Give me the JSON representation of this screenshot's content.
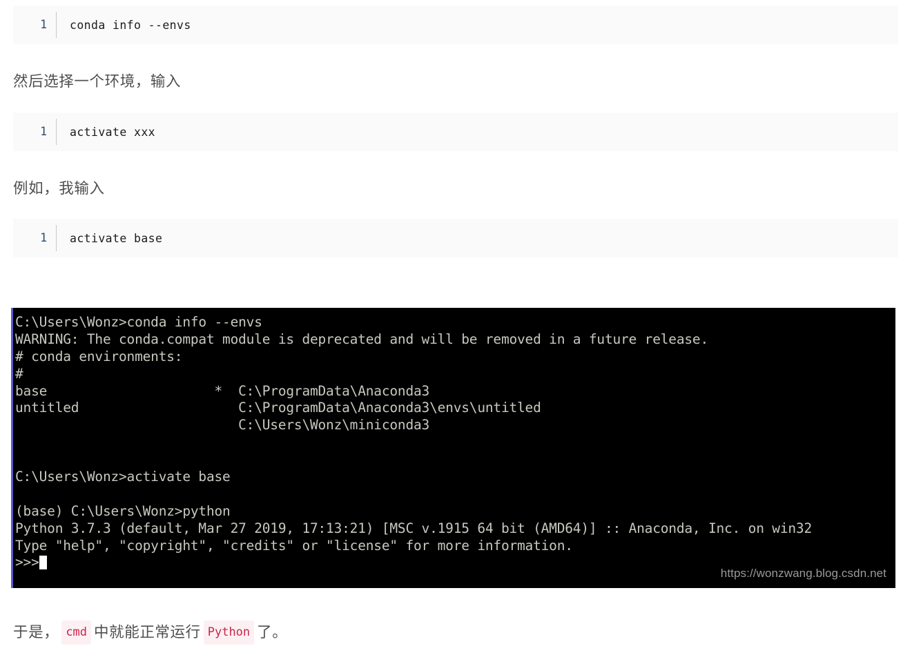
{
  "code_blocks": [
    {
      "line_no": "1",
      "code": "conda info --envs"
    },
    {
      "line_no": "1",
      "code": "activate xxx"
    },
    {
      "line_no": "1",
      "code": "activate base"
    }
  ],
  "paragraphs": {
    "p1": "然后选择一个环境，输入",
    "p2": "例如，我输入",
    "p3": {
      "before": "于是，",
      "code1": "cmd",
      "middle": "中就能正常运行",
      "code2": "Python",
      "after": "了。"
    }
  },
  "terminal": {
    "background": "#000000",
    "text_color": "#c8c8c0",
    "border_color": "#5a5ac8",
    "lines": [
      "C:\\Users\\Wonz>conda info --envs",
      "WARNING: The conda.compat module is deprecated and will be removed in a future release.",
      "# conda environments:",
      "#",
      "base                     *  C:\\ProgramData\\Anaconda3",
      "untitled                    C:\\ProgramData\\Anaconda3\\envs\\untitled",
      "                            C:\\Users\\Wonz\\miniconda3",
      "",
      "",
      "C:\\Users\\Wonz>activate base",
      "",
      "(base) C:\\Users\\Wonz>python",
      "Python 3.7.3 (default, Mar 27 2019, 17:13:21) [MSC v.1915 64 bit (AMD64)] :: Anaconda, Inc. on win32",
      "Type \"help\", \"copyright\", \"credits\" or \"license\" for more information."
    ],
    "prompt": ">>>",
    "watermark": "https://wonzwang.blog.csdn.net"
  },
  "colors": {
    "code_block_bg": "#fafafa",
    "code_text": "#1b1b1b",
    "gutter_text": "#2b4a6f",
    "paragraph_text": "#4f4f4f",
    "inline_code_bg": "#fdf0f3",
    "inline_code_text": "#c7254e"
  }
}
